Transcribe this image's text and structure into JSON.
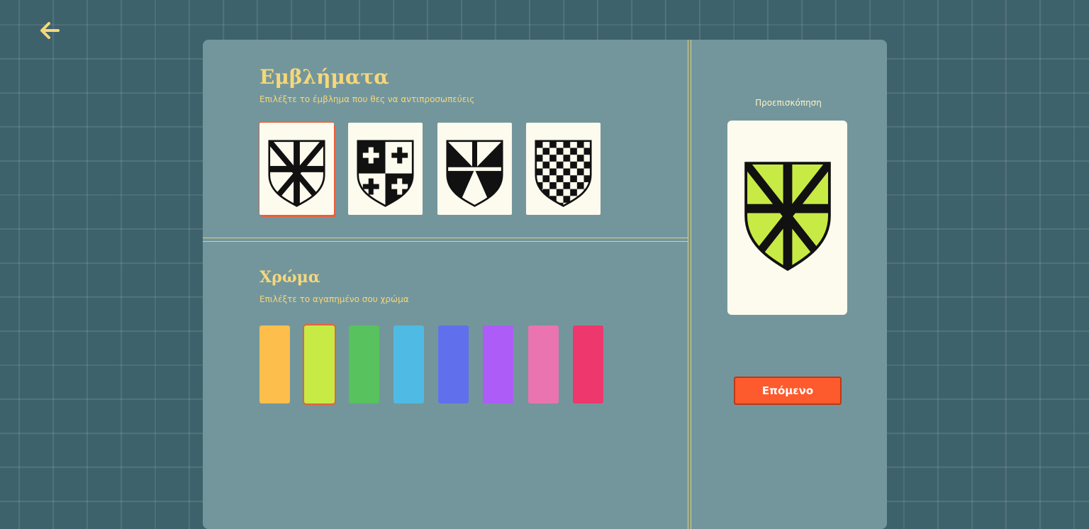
{
  "emblems": {
    "title": "Εμβλήματα",
    "subtitle": "Επιλέξτε το έμβλημα που θες να αντιπροσωπεύεις",
    "options": [
      {
        "name": "star-cross-shield-icon",
        "selected": true
      },
      {
        "name": "quartered-crosses-shield-icon",
        "selected": false
      },
      {
        "name": "gyronny-shield-icon",
        "selected": false
      },
      {
        "name": "checkered-shield-icon",
        "selected": false
      }
    ]
  },
  "colors": {
    "title": "Χρώμα",
    "subtitle": "Επιλέξτε το αγαπημένο σου χρώμα",
    "swatches": [
      {
        "color": "#fdbe4b",
        "selected": false
      },
      {
        "color": "#c8ea45",
        "selected": true
      },
      {
        "color": "#58c25e",
        "selected": false
      },
      {
        "color": "#4fbbe4",
        "selected": false
      },
      {
        "color": "#6070ed",
        "selected": false
      },
      {
        "color": "#ae5cf7",
        "selected": false
      },
      {
        "color": "#ea74b0",
        "selected": false
      },
      {
        "color": "#ed376d",
        "selected": false
      }
    ]
  },
  "preview": {
    "label": "Προεπισκόπηση",
    "emblem": "star-cross-shield-icon",
    "fill_color": "#c8ea45"
  },
  "next_button": {
    "label": "Επόμενο"
  },
  "accent_color": "#f5d77a",
  "selection_color": "#e8603a"
}
